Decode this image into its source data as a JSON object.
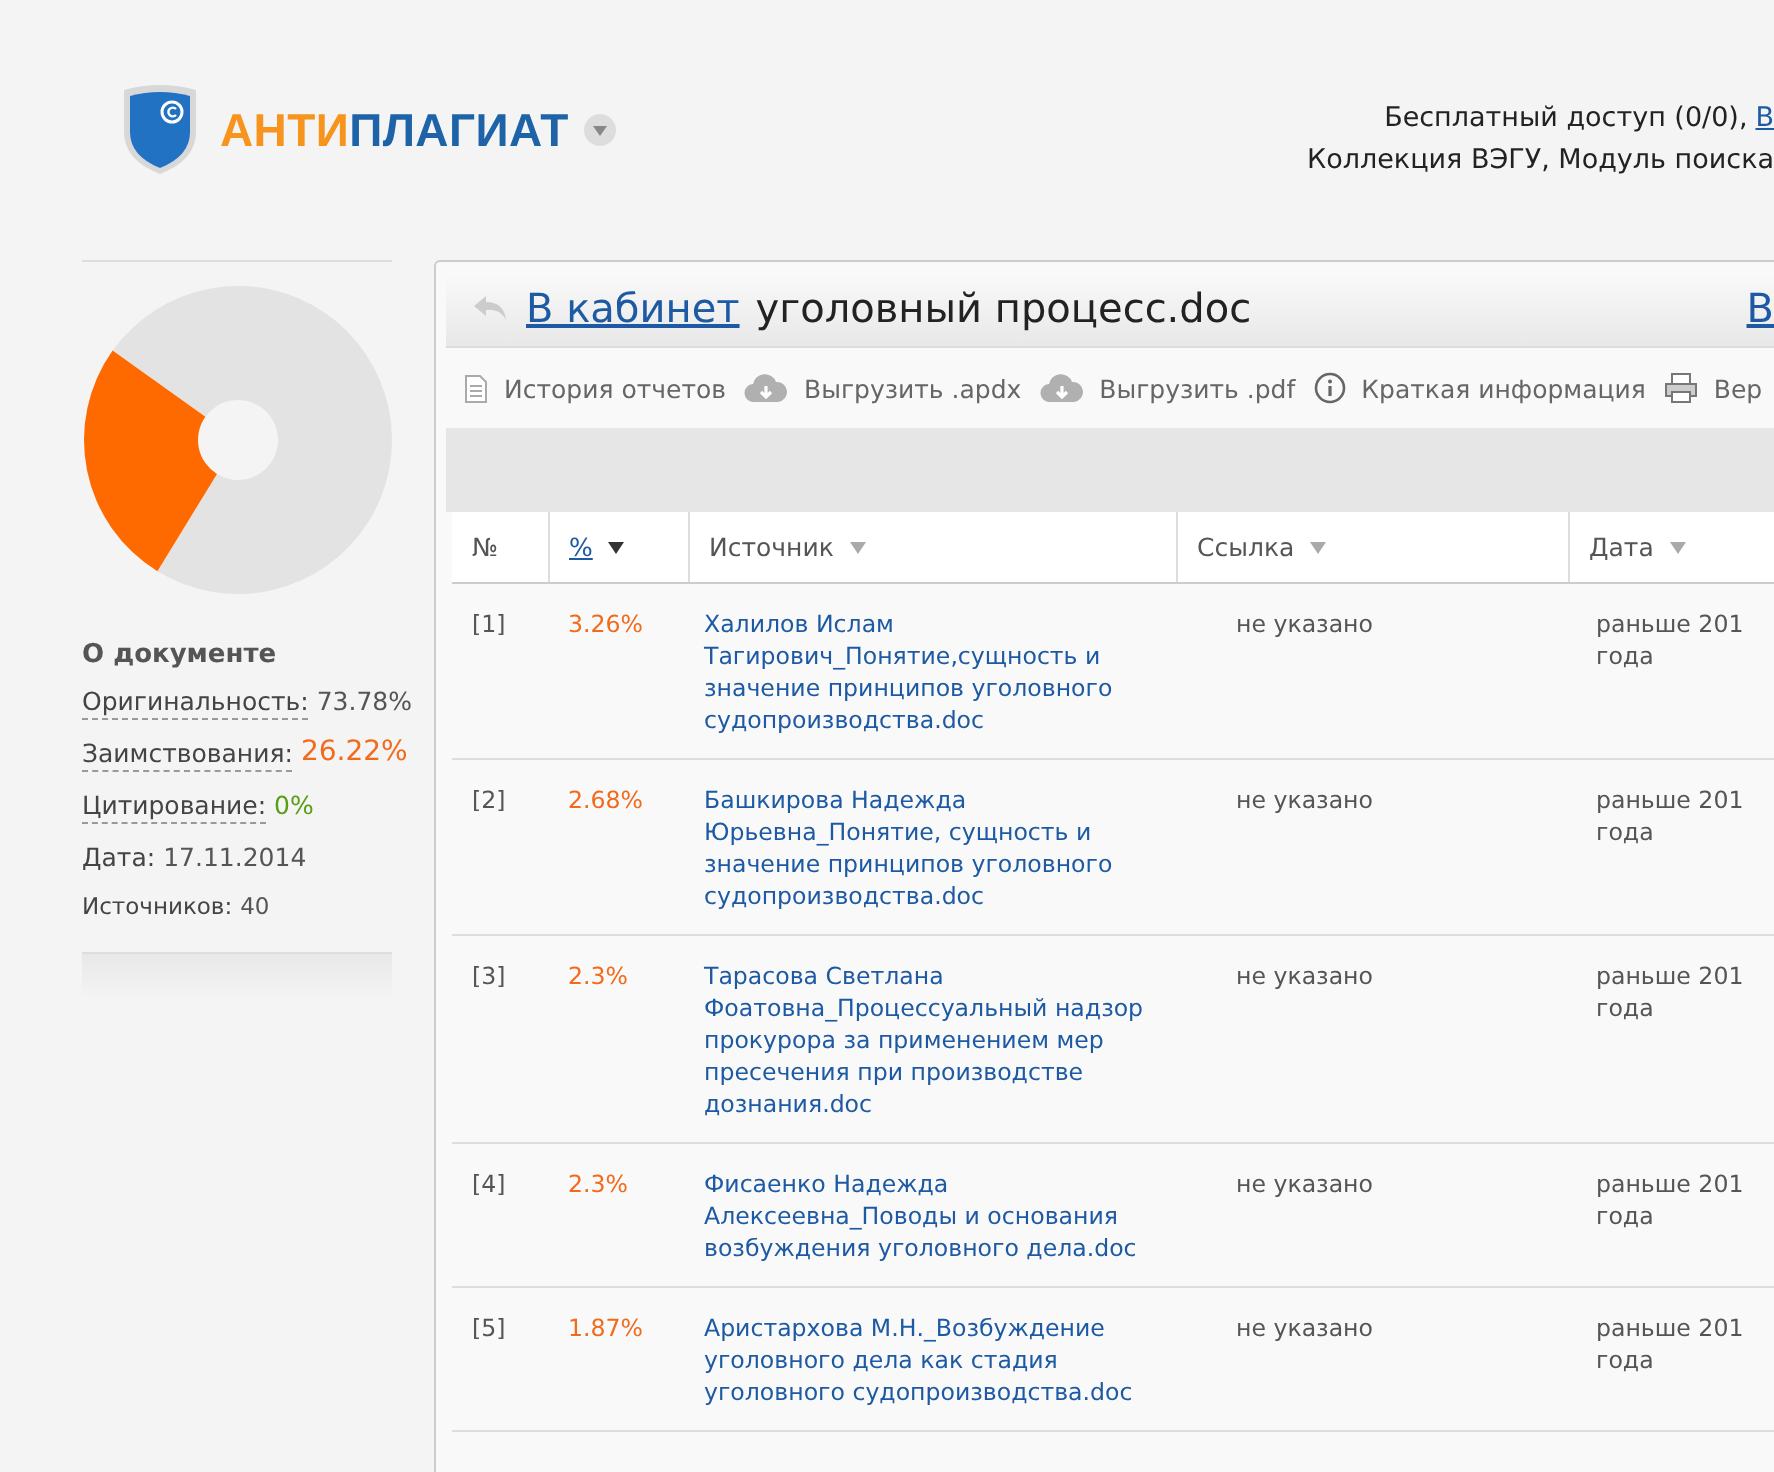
{
  "header": {
    "logo": {
      "part_1": "АНТИ",
      "part_2": "ПЛАГИАТ"
    },
    "access_text": "Бесплатный доступ (0/0),",
    "access_link": "В",
    "collection_text": "Коллекция ВЭГУ, Модуль поиска"
  },
  "sidebar": {
    "title": "О документе",
    "stats": [
      {
        "kind": "original",
        "label": "Оригинальность:",
        "value": "73.78%"
      },
      {
        "kind": "borrowed",
        "label": "Заимствования:",
        "value": "26.22%"
      },
      {
        "kind": "cited",
        "label": "Цитирование:",
        "value": "0%"
      },
      {
        "kind": "plain",
        "label": "Дата:",
        "value": "17.11.2014"
      },
      {
        "kind": "small",
        "label": "Источников:",
        "value": "40"
      }
    ]
  },
  "panel": {
    "back_link": "В кабинет",
    "document_title": "уголовный процесс.doc",
    "right_link": "В",
    "toolbar": [
      {
        "kind": "history",
        "label": "История отчетов"
      },
      {
        "kind": "download",
        "label": "Выгрузить .apdx"
      },
      {
        "kind": "download",
        "label": "Выгрузить .pdf"
      },
      {
        "kind": "info",
        "label": "Краткая информация"
      },
      {
        "kind": "print",
        "label": "Вер"
      }
    ],
    "table": {
      "columns": [
        {
          "label": "№",
          "kind": "plain",
          "selected": false
        },
        {
          "label": "%",
          "kind": "sortable",
          "selected": true
        },
        {
          "label": "Источник",
          "kind": "sortable",
          "selected": false
        },
        {
          "label": "Ссылка",
          "kind": "sortable",
          "selected": false
        },
        {
          "label": "Дата",
          "kind": "sortable",
          "selected": false
        }
      ],
      "rows": [
        {
          "number": "[1]",
          "percent": "3.26%",
          "source": "Халилов Ислам Тагирович_Понятие,сущность и значение принципов уголовного судопроизводства.doc",
          "link": "не указано",
          "date": "раньше 201 года"
        },
        {
          "number": "[2]",
          "percent": "2.68%",
          "source": "Башкирова Надежда Юрьевна_Понятие, сущность и значение принципов уголовного судопроизводства.doc",
          "link": "не указано",
          "date": "раньше 201 года"
        },
        {
          "number": "[3]",
          "percent": "2.3%",
          "source": "Тарасова Светлана Фоатовна_Процессуальный надзор прокурора за применением мер пресечения при производстве дознания.doc",
          "link": "не указано",
          "date": "раньше 201 года"
        },
        {
          "number": "[4]",
          "percent": "2.3%",
          "source": "Фисаенко Надежда Алексеевна_Поводы и основания возбуждения уголовного дела.doc",
          "link": "не указано",
          "date": "раньше 201 года"
        },
        {
          "number": "[5]",
          "percent": "1.87%",
          "source": "Аристархова М.Н._Возбуждение уголовного дела как стадия уголовного судопроизводства.doc",
          "link": "не указано",
          "date": "раньше 201 года"
        }
      ]
    }
  }
}
